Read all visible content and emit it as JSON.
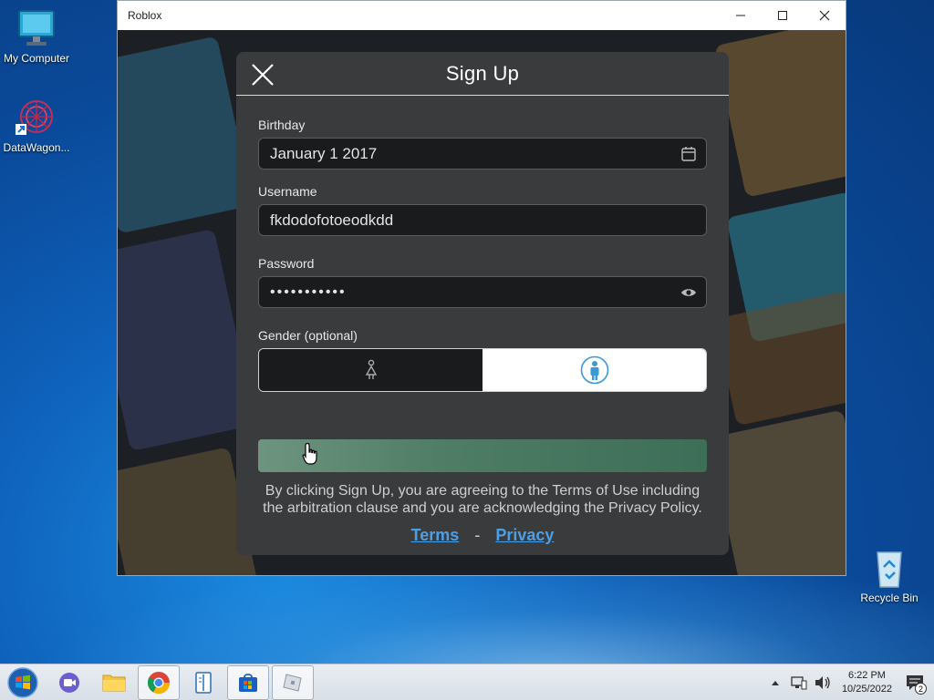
{
  "desktop": {
    "icons": [
      {
        "label": "My Computer",
        "icon": "monitor-icon"
      },
      {
        "label": "DataWagon...",
        "icon": "datawagon-icon"
      },
      {
        "label": "Recycle Bin",
        "icon": "recycle-bin-icon"
      }
    ]
  },
  "window": {
    "title": "Roblox",
    "controls": [
      "minimize",
      "maximize",
      "close"
    ]
  },
  "signup": {
    "title": "Sign Up",
    "birthday": {
      "label": "Birthday",
      "value": "January 1 2017",
      "icon": "calendar-icon"
    },
    "username": {
      "label": "Username",
      "value": "fkdodofotoeodkdd"
    },
    "password": {
      "label": "Password",
      "value": "•••••••••••",
      "icon": "eye-icon"
    },
    "gender": {
      "label": "Gender (optional)",
      "options": [
        "female",
        "male"
      ],
      "selected": "male"
    },
    "button_label": "",
    "legal_text": "By clicking Sign Up, you are agreeing to the Terms of Use including the arbitration clause and you are acknowledging the Privacy Policy.",
    "links": {
      "terms": "Terms",
      "separator": "-",
      "privacy": "Privacy"
    },
    "colors": {
      "link": "#4aa0e8",
      "button": "#4f7d66",
      "modal_bg": "#393b3d"
    }
  },
  "taskbar": {
    "apps": [
      "start-orb",
      "meet-icon",
      "file-explorer-icon",
      "chrome-icon",
      "notepad-icon",
      "store-icon",
      "roblox-icon"
    ],
    "clock": {
      "time": "6:22 PM",
      "date": "10/25/2022"
    },
    "notifications": "2"
  }
}
